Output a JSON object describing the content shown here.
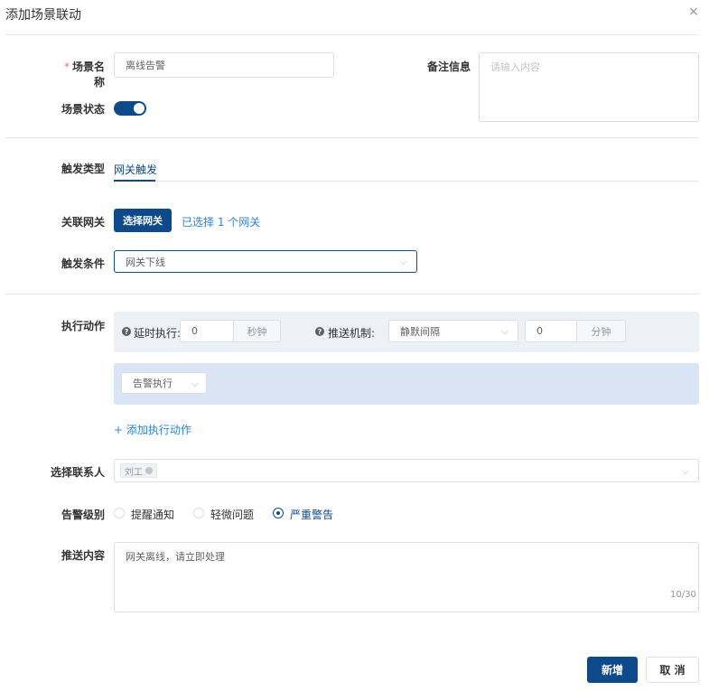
{
  "dialog": {
    "title": "添加场景联动",
    "close_glyph": "×"
  },
  "form": {
    "scene_name": {
      "label": "场景名称",
      "required_mark": "*",
      "value": "离线告警"
    },
    "remark": {
      "label": "备注信息",
      "placeholder": "请输入内容"
    },
    "scene_status": {
      "label": "场景状态",
      "enabled": true
    },
    "trigger_type": {
      "label": "触发类型",
      "tab": "网关触发"
    },
    "gateway": {
      "label": "关联网关",
      "button": "选择网关",
      "selected_text": "已选择 1 个网关"
    },
    "trigger_condition": {
      "label": "触发条件",
      "value": "网关下线"
    },
    "actions": {
      "label": "执行动作",
      "delay_label": "延时执行:",
      "delay_value": "0",
      "delay_unit": "秒钟",
      "push_label": "推送机制:",
      "push_value": "静默间隔",
      "interval_value": "0",
      "interval_unit": "分钟",
      "action_select": "告警执行",
      "add_action": "+ 添加执行动作"
    },
    "contacts": {
      "label": "选择联系人",
      "tags": [
        "刘工"
      ]
    },
    "alarm_level": {
      "label": "告警级别",
      "options": [
        "提醒通知",
        "轻微问题",
        "严重警告"
      ],
      "selected": "严重警告"
    },
    "push_content": {
      "label": "推送内容",
      "value": "网关离线，请立即处理",
      "counter": "10/30"
    }
  },
  "footer": {
    "submit": "新增",
    "cancel": "取 消"
  },
  "colors": {
    "primary": "#0d4a8c",
    "link": "#2b85e4",
    "required": "#f56c6c"
  }
}
